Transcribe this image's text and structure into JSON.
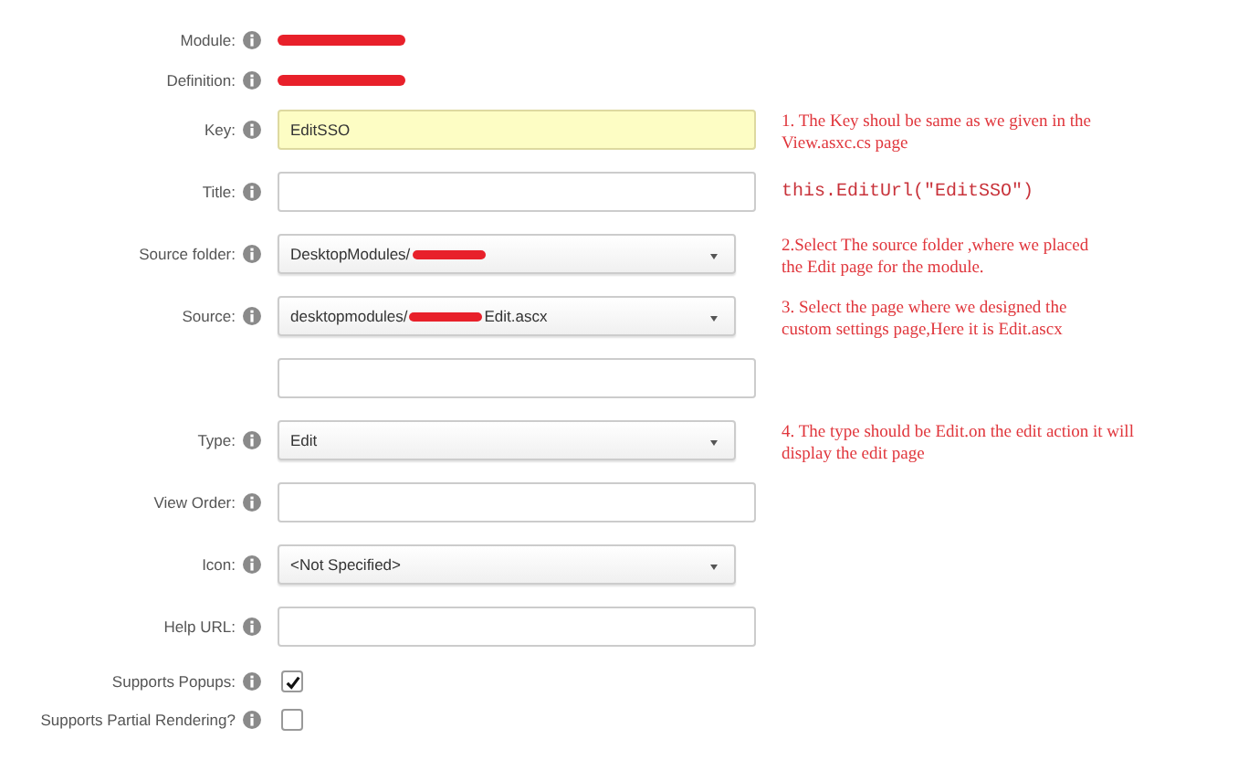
{
  "rows": [
    {
      "label": "Module:",
      "kind": "redacted"
    },
    {
      "label": "Definition:",
      "kind": "redacted"
    },
    {
      "label": "Key:",
      "kind": "text",
      "value": "EditSSO",
      "highlighted": true,
      "note": {
        "kind": "prose",
        "text": "1. The Key shoul be same as we given in the\nView.asxc.cs page"
      }
    },
    {
      "label": "Title:",
      "kind": "text",
      "highlighted": false,
      "note": {
        "kind": "code",
        "text": "this.EditUrl(\"EditSSO\")"
      }
    },
    {
      "label": "Source folder:",
      "kind": "select",
      "parts": [
        {
          "kind": "text",
          "text": "DesktopModules/"
        },
        {
          "kind": "redacted"
        }
      ],
      "note": {
        "kind": "prose",
        "text": "2.Select The source folder ,where we placed\nthe Edit page for the module."
      }
    },
    {
      "label": "Source:",
      "kind": "select",
      "parts": [
        {
          "kind": "text",
          "text": "desktopmodules/"
        },
        {
          "kind": "redacted"
        },
        {
          "kind": "text",
          "text": "Edit.ascx"
        }
      ],
      "note": {
        "kind": "prose",
        "text": "3. Select the page where we designed the\ncustom settings page,Here it is Edit.ascx"
      }
    },
    {
      "kind": "text",
      "highlighted": false
    },
    {
      "label": "Type:",
      "kind": "select",
      "parts": [
        {
          "kind": "text",
          "text": "Edit"
        }
      ],
      "note": {
        "kind": "prose",
        "text": "4. The type should be Edit.on the edit action it will\ndisplay the edit page"
      }
    },
    {
      "label": "View Order:",
      "kind": "text",
      "highlighted": false
    },
    {
      "label": "Icon:",
      "kind": "select",
      "parts": [
        {
          "kind": "text",
          "text": "<Not Specified>"
        }
      ]
    },
    {
      "label": "Help URL:",
      "kind": "text",
      "highlighted": false
    },
    {
      "label": "Supports Popups:",
      "kind": "checkbox",
      "checked": true
    },
    {
      "label": "Supports Partial Rendering?",
      "kind": "checkbox",
      "checked": false
    }
  ]
}
